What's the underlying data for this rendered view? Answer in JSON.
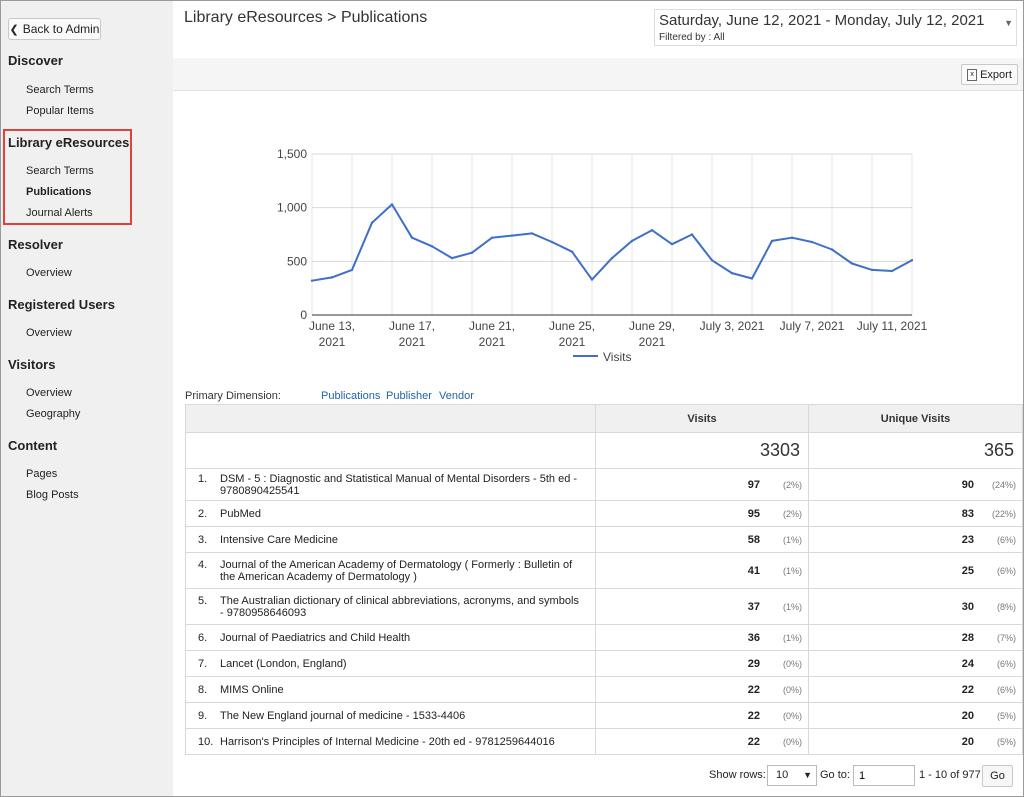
{
  "sidebar": {
    "back_label": "Back to Admin",
    "sections": [
      {
        "title": "Discover",
        "items": [
          {
            "label": "Search Terms"
          },
          {
            "label": "Popular Items"
          }
        ]
      },
      {
        "title": "Library eResources",
        "items": [
          {
            "label": "Search Terms"
          },
          {
            "label": "Publications",
            "active": true
          },
          {
            "label": "Journal Alerts"
          }
        ]
      },
      {
        "title": "Resolver",
        "items": [
          {
            "label": "Overview"
          }
        ]
      },
      {
        "title": "Registered Users",
        "items": [
          {
            "label": "Overview"
          }
        ]
      },
      {
        "title": "Visitors",
        "items": [
          {
            "label": "Overview"
          },
          {
            "label": "Geography"
          }
        ]
      },
      {
        "title": "Content",
        "items": [
          {
            "label": "Pages"
          },
          {
            "label": "Blog Posts"
          }
        ]
      }
    ]
  },
  "header": {
    "title": "Library eResources > Publications",
    "date_range": "Saturday, June 12, 2021  -  Monday, July 12, 2021",
    "filter": "Filtered by : All"
  },
  "toolbar": {
    "export_label": "Export"
  },
  "chart_data": {
    "type": "line",
    "xlabel": "",
    "ylabel": "",
    "ylim": [
      0,
      1500
    ],
    "yticks": [
      "1,500",
      "1,000",
      "500",
      "0"
    ],
    "xtick_labels": [
      {
        "line1": "June 13,",
        "line2": "2021"
      },
      {
        "line1": "June 17,",
        "line2": "2021"
      },
      {
        "line1": "June 21,",
        "line2": "2021"
      },
      {
        "line1": "June 25,",
        "line2": "2021"
      },
      {
        "line1": "June 29,",
        "line2": "2021"
      },
      {
        "line1": "July 3, 2021",
        "line2": ""
      },
      {
        "line1": "July 7, 2021",
        "line2": ""
      },
      {
        "line1": "July 11, 2021",
        "line2": ""
      }
    ],
    "x": [
      "2021-06-12",
      "2021-06-13",
      "2021-06-14",
      "2021-06-15",
      "2021-06-16",
      "2021-06-17",
      "2021-06-18",
      "2021-06-19",
      "2021-06-20",
      "2021-06-21",
      "2021-06-22",
      "2021-06-23",
      "2021-06-24",
      "2021-06-25",
      "2021-06-26",
      "2021-06-27",
      "2021-06-28",
      "2021-06-29",
      "2021-06-30",
      "2021-07-01",
      "2021-07-02",
      "2021-07-03",
      "2021-07-04",
      "2021-07-05",
      "2021-07-06",
      "2021-07-07",
      "2021-07-08",
      "2021-07-09",
      "2021-07-10",
      "2021-07-11",
      "2021-07-12"
    ],
    "series": [
      {
        "name": "Visits",
        "color": "#3f6fc9",
        "values": [
          320,
          350,
          420,
          860,
          1030,
          720,
          640,
          530,
          580,
          720,
          740,
          760,
          680,
          590,
          330,
          530,
          690,
          790,
          660,
          750,
          510,
          390,
          340,
          690,
          720,
          680,
          610,
          480,
          420,
          410,
          510
        ]
      }
    ],
    "grid": true,
    "legend": "bottom"
  },
  "dimensions": {
    "label": "Primary Dimension:",
    "options": [
      "Publications",
      "Publisher",
      "Vendor"
    ]
  },
  "table": {
    "headers": {
      "visits": "Visits",
      "unique": "Unique Visits"
    },
    "totals": {
      "visits": "3303",
      "unique": "365"
    },
    "rows": [
      {
        "rank": "1.",
        "name": "DSM - 5 : Diagnostic and Statistical Manual of Mental Disorders - 5th ed - 9780890425541",
        "visits": "97",
        "visits_pct": "(2%)",
        "unique": "90",
        "unique_pct": "(24%)"
      },
      {
        "rank": "2.",
        "name": "PubMed",
        "visits": "95",
        "visits_pct": "(2%)",
        "unique": "83",
        "unique_pct": "(22%)"
      },
      {
        "rank": "3.",
        "name": "Intensive Care Medicine",
        "visits": "58",
        "visits_pct": "(1%)",
        "unique": "23",
        "unique_pct": "(6%)"
      },
      {
        "rank": "4.",
        "name": "Journal of the American Academy of Dermatology ( Formerly : Bulletin of the American Academy of Dermatology )",
        "visits": "41",
        "visits_pct": "(1%)",
        "unique": "25",
        "unique_pct": "(6%)"
      },
      {
        "rank": "5.",
        "name": "The Australian dictionary of clinical abbreviations, acronyms, and symbols - 9780958646093",
        "visits": "37",
        "visits_pct": "(1%)",
        "unique": "30",
        "unique_pct": "(8%)"
      },
      {
        "rank": "6.",
        "name": "Journal of Paediatrics and Child Health",
        "visits": "36",
        "visits_pct": "(1%)",
        "unique": "28",
        "unique_pct": "(7%)"
      },
      {
        "rank": "7.",
        "name": "Lancet (London, England)",
        "visits": "29",
        "visits_pct": "(0%)",
        "unique": "24",
        "unique_pct": "(6%)"
      },
      {
        "rank": "8.",
        "name": "MIMS Online",
        "visits": "22",
        "visits_pct": "(0%)",
        "unique": "22",
        "unique_pct": "(6%)"
      },
      {
        "rank": "9.",
        "name": "The New England journal of medicine - 1533-4406",
        "visits": "22",
        "visits_pct": "(0%)",
        "unique": "20",
        "unique_pct": "(5%)"
      },
      {
        "rank": "10.",
        "name": "Harrison's Principles of Internal Medicine - 20th ed - 9781259644016",
        "visits": "22",
        "visits_pct": "(0%)",
        "unique": "20",
        "unique_pct": "(5%)"
      }
    ]
  },
  "pager": {
    "show_rows_label": "Show rows:",
    "rows_value": "10",
    "goto_label": "Go to:",
    "goto_value": "1",
    "range_text": "1 - 10 of 977",
    "go_label": "Go"
  }
}
